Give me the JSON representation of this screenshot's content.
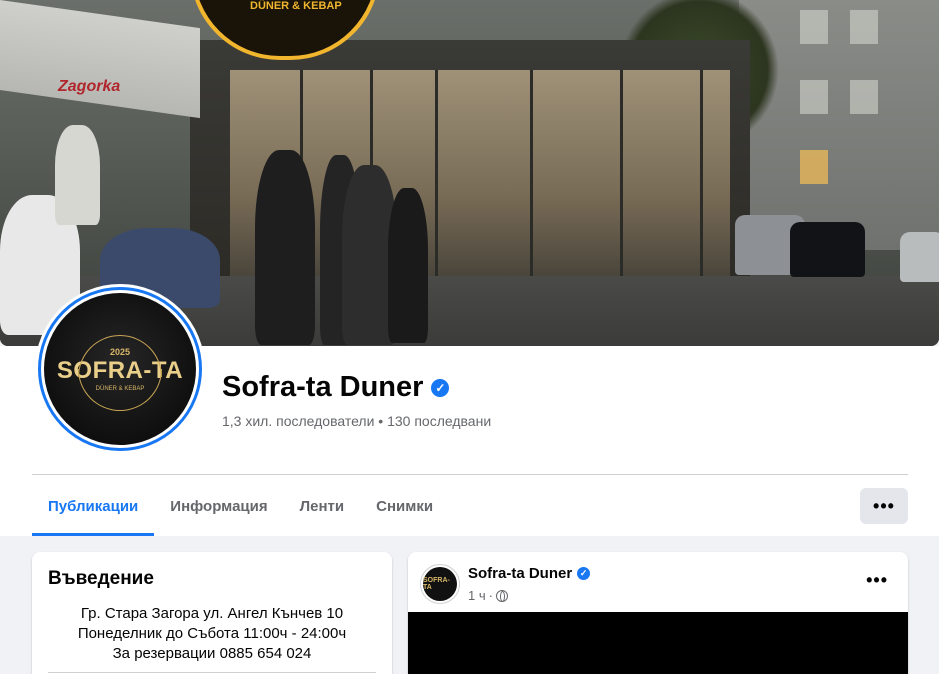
{
  "cover": {
    "sign_text": "DÜNER & KEBAP",
    "awning_brand": "Zagorka"
  },
  "profile": {
    "logo_year": "2025",
    "logo_name": "SOFRA-TA",
    "logo_sub": "DÜNER & KEBAP",
    "name": "Sofra-ta Duner",
    "stats": "1,3 хил. последователи • 130 последвани"
  },
  "tabs": [
    {
      "label": "Публикации",
      "active": true
    },
    {
      "label": "Информация",
      "active": false
    },
    {
      "label": "Ленти",
      "active": false
    },
    {
      "label": "Снимки",
      "active": false
    }
  ],
  "more_label": "•••",
  "intro": {
    "title": "Въведение",
    "lines": [
      "Гр. Стара Загора ул. Ангел Кънчев 10",
      "Понеделник до Събота 11:00ч - 24:00ч",
      "За резервации 0885 654 024"
    ]
  },
  "post": {
    "avatar_text": "SOFRA-TA",
    "author": "Sofra-ta Duner",
    "time": "1 ч",
    "separator": "·",
    "more_label": "•••"
  },
  "colors": {
    "accent": "#1877f2",
    "muted": "#65676b",
    "background": "#f0f2f5"
  }
}
